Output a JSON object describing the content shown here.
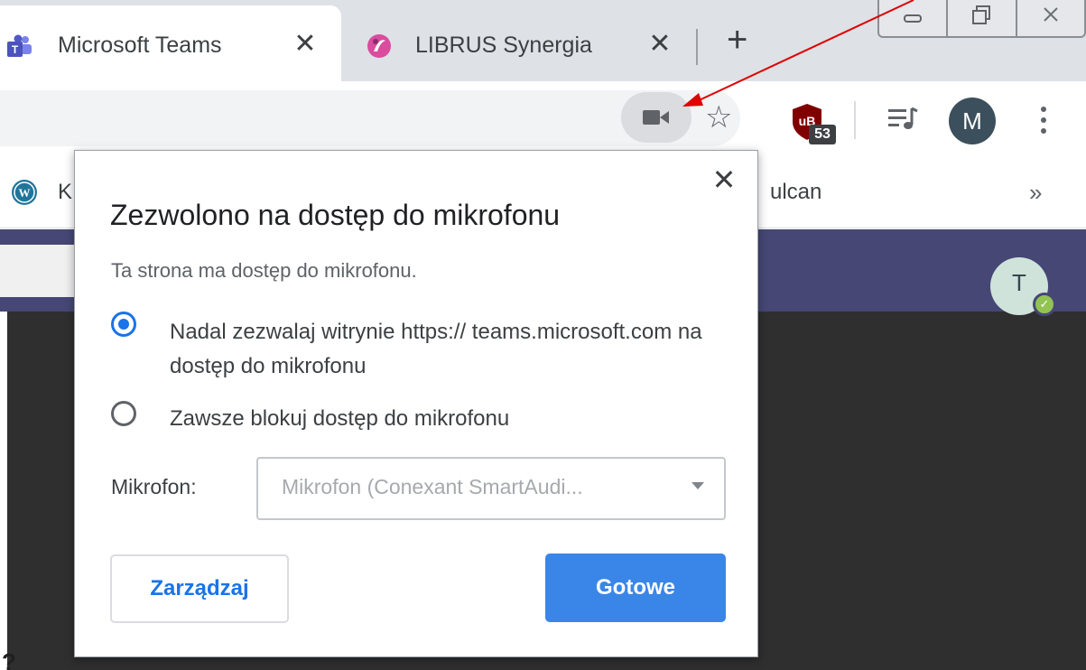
{
  "tabs": [
    {
      "title": "Microsoft Teams",
      "close": "✕",
      "active": true
    },
    {
      "title": "LIBRUS Synergia",
      "close": "✕",
      "active": false
    }
  ],
  "new_tab": "+",
  "toolbar": {
    "ublock_badge": "53",
    "profile_initial": "M"
  },
  "bookmarks": {
    "item_1": "K",
    "item_2": "ulcan",
    "overflow": "»"
  },
  "teams": {
    "user_initial": "T"
  },
  "dialog": {
    "close": "✕",
    "title": "Zezwolono na dostęp do mikrofonu",
    "description": "Ta strona ma dostęp do mikrofonu.",
    "options": [
      {
        "label": "Nadal zezwalaj witrynie https:// teams.microsoft.com na dostęp do mikrofonu",
        "selected": true
      },
      {
        "label": "Zawsze blokuj dostęp do mikrofonu",
        "selected": false
      }
    ],
    "microphone_label": "Mikrofon:",
    "microphone_value": "Mikrofon (Conexant SmartAudi...",
    "manage_button": "Zarządzaj",
    "done_button": "Gotowe"
  },
  "colors": {
    "accent_blue": "#1a73e8",
    "teams_purple": "#464775",
    "annotation_arrow": "#e00000"
  }
}
